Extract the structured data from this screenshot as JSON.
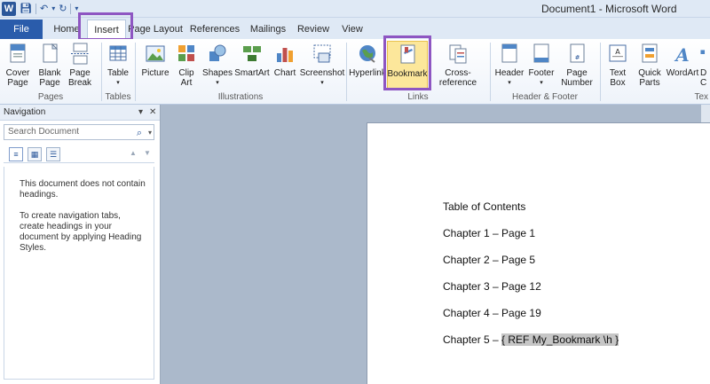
{
  "titlebar": {
    "app_title": "Document1 - Microsoft Word",
    "logo_letter": "W"
  },
  "tabs": {
    "file": "File",
    "items": [
      "Home",
      "Insert",
      "Page Layout",
      "References",
      "Mailings",
      "Review",
      "View"
    ],
    "active": "Insert"
  },
  "ribbon": {
    "buttons": {
      "cover_page": "Cover\nPage",
      "blank_page": "Blank\nPage",
      "page_break": "Page\nBreak",
      "table": "Table",
      "picture": "Picture",
      "clip_art": "Clip\nArt",
      "shapes": "Shapes",
      "smartart": "SmartArt",
      "chart": "Chart",
      "screenshot": "Screenshot",
      "hyperlink": "Hyperlink",
      "bookmark": "Bookmark",
      "cross_reference": "Cross-reference",
      "header": "Header",
      "footer": "Footer",
      "page_number": "Page\nNumber",
      "text_box": "Text\nBox",
      "quick_parts": "Quick\nParts",
      "wordart": "WordArt",
      "cut_off": "D\nC"
    },
    "groups": {
      "pages": "Pages",
      "tables": "Tables",
      "illustrations": "Illustrations",
      "links": "Links",
      "header_footer": "Header & Footer",
      "text": "Tex"
    }
  },
  "navigation": {
    "title": "Navigation",
    "search_placeholder": "Search Document",
    "message_1": "This document does not contain headings.",
    "message_2": "To create navigation tabs, create headings in your document by applying Heading Styles."
  },
  "document": {
    "heading": "Table of Contents",
    "lines": [
      "Chapter 1 – Page 1",
      "Chapter 2 – Page 5",
      "Chapter 3 – Page 12",
      "Chapter 4 – Page 19"
    ],
    "chapter5_prefix": "Chapter 5 – ",
    "field_code": "{ REF My_Bookmark \\h }"
  },
  "colors": {
    "highlight_box": "#8e56c2",
    "file_tab": "#2a5cab",
    "selected_button": "#fce79b"
  }
}
